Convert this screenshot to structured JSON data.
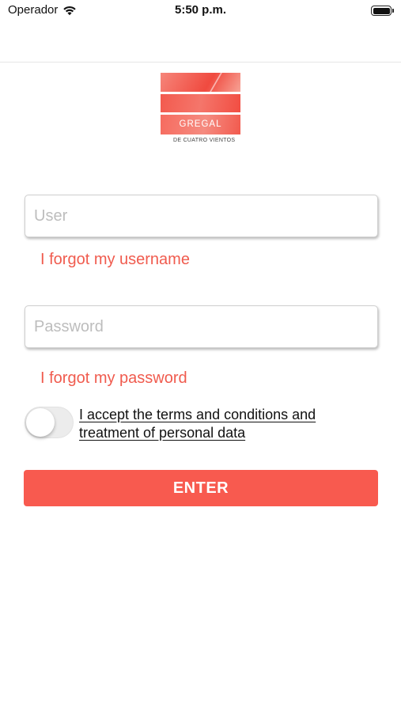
{
  "status_bar": {
    "carrier": "Operador",
    "time": "5:50 p.m.",
    "wifi_icon": "wifi-icon",
    "battery_icon": "battery-icon"
  },
  "logo": {
    "name": "GREGAL",
    "subtitle": "DE CUATRO VIENTOS"
  },
  "login": {
    "user_placeholder": "User",
    "user_value": "",
    "forgot_username": "I forgot my username",
    "password_placeholder": "Password",
    "password_value": "",
    "forgot_password": "I forgot my password",
    "terms_toggle_on": false,
    "terms_text": "I accept the terms and conditions and treatment of personal data",
    "enter_label": "ENTER"
  },
  "colors": {
    "accent": "#f85a4f",
    "link": "#f05b4e",
    "placeholder": "#bdbdbd"
  }
}
